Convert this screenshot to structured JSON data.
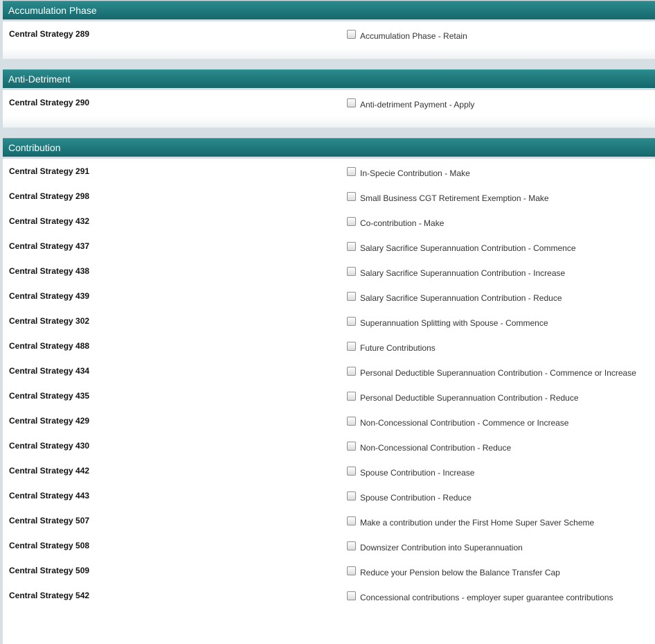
{
  "sections": [
    {
      "title": "Accumulation Phase",
      "rows": [
        {
          "code": "Central Strategy 289",
          "label": "Accumulation Phase - Retain"
        }
      ]
    },
    {
      "title": "Anti-Detriment",
      "rows": [
        {
          "code": "Central Strategy 290",
          "label": "Anti-detriment Payment - Apply"
        }
      ]
    },
    {
      "title": "Contribution",
      "rows": [
        {
          "code": "Central Strategy 291",
          "label": "In-Specie Contribution - Make"
        },
        {
          "code": "Central Strategy 298",
          "label": "Small Business CGT Retirement Exemption - Make"
        },
        {
          "code": "Central Strategy 432",
          "label": "Co-contribution - Make"
        },
        {
          "code": "Central Strategy 437",
          "label": "Salary Sacrifice Superannuation Contribution - Commence"
        },
        {
          "code": "Central Strategy 438",
          "label": "Salary Sacrifice Superannuation Contribution - Increase"
        },
        {
          "code": "Central Strategy 439",
          "label": "Salary Sacrifice Superannuation Contribution - Reduce"
        },
        {
          "code": "Central Strategy 302",
          "label": "Superannuation Splitting with Spouse - Commence"
        },
        {
          "code": "Central Strategy 488",
          "label": "Future Contributions"
        },
        {
          "code": "Central Strategy 434",
          "label": "Personal Deductible Superannuation Contribution - Commence or Increase"
        },
        {
          "code": "Central Strategy 435",
          "label": "Personal Deductible Superannuation Contribution - Reduce"
        },
        {
          "code": "Central Strategy 429",
          "label": "Non-Concessional Contribution - Commence or Increase"
        },
        {
          "code": "Central Strategy 430",
          "label": "Non-Concessional Contribution - Reduce"
        },
        {
          "code": "Central Strategy 442",
          "label": "Spouse Contribution - Increase"
        },
        {
          "code": "Central Strategy 443",
          "label": "Spouse Contribution - Reduce"
        },
        {
          "code": "Central Strategy 507",
          "label": "Make a contribution under the First Home Super Saver Scheme"
        },
        {
          "code": "Central Strategy 508",
          "label": "Downsizer Contribution into Superannuation"
        },
        {
          "code": "Central Strategy 509",
          "label": "Reduce your Pension below the Balance Transfer Cap"
        },
        {
          "code": "Central Strategy 542",
          "label": "Concessional contributions - employer super guarantee contributions"
        }
      ]
    }
  ]
}
